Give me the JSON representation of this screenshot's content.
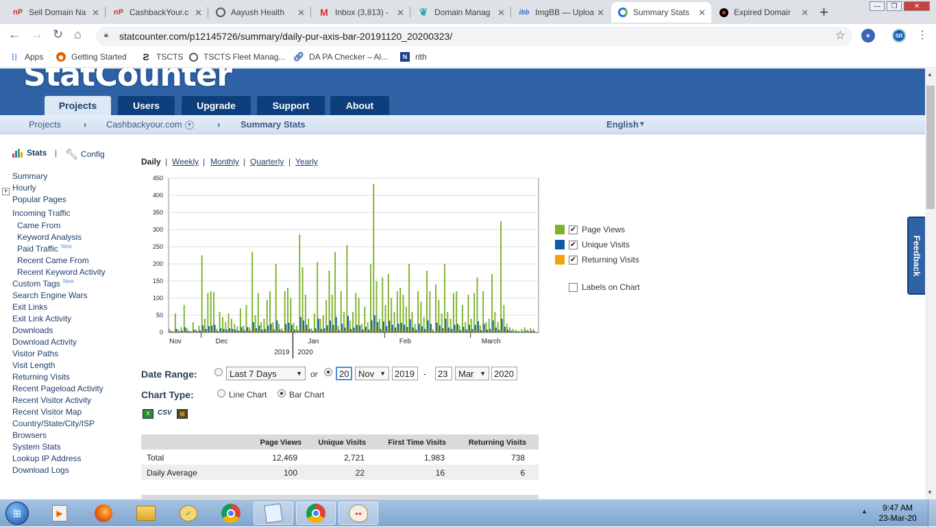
{
  "browser": {
    "tabs": [
      {
        "title": "Sell Domain Na",
        "icon": "nP"
      },
      {
        "title": "CashbackYour.c",
        "icon": "nP"
      },
      {
        "title": "Aayush Health",
        "icon": "globe"
      },
      {
        "title": "Inbox (3,813) -",
        "icon": "M"
      },
      {
        "title": "Domain Manag",
        "icon": "leaf"
      },
      {
        "title": "ImgBB — Uploa",
        "icon": "ibb"
      },
      {
        "title": "Summary Stats",
        "icon": "statcounter"
      },
      {
        "title": "Expired Domair",
        "icon": "dot"
      }
    ],
    "url": "statcounter.com/p12145726/summary/daily-pur-axis-bar-20191120_20200323/",
    "bookmarks": [
      {
        "label": "Apps"
      },
      {
        "label": "Getting Started"
      },
      {
        "label": "TSCTS"
      },
      {
        "label": "TSCTS Fleet Manag..."
      },
      {
        "label": "DA PA Checker – Al..."
      },
      {
        "label": "rith"
      }
    ],
    "extension_badge": "SR"
  },
  "site": {
    "logo_text": "StatCounter",
    "nav_tabs": [
      "Projects",
      "Users",
      "Upgrade",
      "Support",
      "About"
    ],
    "breadcrumb": [
      "Projects",
      "Cashbackyour.com",
      "Summary Stats"
    ],
    "language": "English",
    "feedback": "Feedback"
  },
  "sidebar": {
    "stats_label": "Stats",
    "config_label": "Config",
    "items": [
      "Summary",
      "Hourly",
      "Popular Pages",
      "Incoming Traffic",
      "Came From",
      "Keyword Analysis",
      "Paid Traffic",
      "Recent Came From",
      "Recent Keyword Activity",
      "Custom Tags",
      "Search Engine Wars",
      "Exit Links",
      "Exit Link Activity",
      "Downloads",
      "Download Activity",
      "Visitor Paths",
      "Visit Length",
      "Returning Visits",
      "Recent Pageload Activity",
      "Recent Visitor Activity",
      "Recent Visitor Map",
      "Country/State/City/ISP",
      "Browsers",
      "System Stats",
      "Lookup IP Address",
      "Download Logs"
    ],
    "new_tag": "New"
  },
  "periods": [
    "Daily",
    "Weekly",
    "Monthly",
    "Quarterly",
    "Yearly"
  ],
  "legend": {
    "items": [
      {
        "label": "Page Views",
        "color": "#7cb32c",
        "checked": true
      },
      {
        "label": "Unique Visits",
        "color": "#0e5aa7",
        "checked": true
      },
      {
        "label": "Returning Visits",
        "color": "#f0a30a",
        "checked": true
      }
    ],
    "labels_on_chart": "Labels on Chart"
  },
  "controls": {
    "date_range_label": "Date Range:",
    "range_preset": "Last 7 Days",
    "or": "or",
    "from_day": "20",
    "from_month": "Nov",
    "from_year": "2019",
    "dash": "-",
    "to_day": "23",
    "to_month": "Mar",
    "to_year": "2020",
    "chart_type_label": "Chart Type:",
    "line_chart": "Line Chart",
    "bar_chart": "Bar Chart",
    "export_csv": "CSV"
  },
  "table": {
    "headers": [
      "Page Views",
      "Unique Visits",
      "First Time Visits",
      "Returning Visits"
    ],
    "rows": [
      {
        "label": "Total",
        "values": [
          "12,469",
          "2,721",
          "1,983",
          "738"
        ]
      },
      {
        "label": "Daily Average",
        "values": [
          "100",
          "22",
          "16",
          "6"
        ]
      }
    ]
  },
  "taskbar": {
    "time": "9:47 AM",
    "date": "23-Mar-20"
  },
  "chart_data": {
    "type": "bar",
    "x_start": "2019-11-20",
    "x_end": "2020-03-23",
    "ylim": [
      0,
      450
    ],
    "yticks": [
      0,
      50,
      100,
      150,
      200,
      250,
      300,
      350,
      400,
      450
    ],
    "month_labels": [
      "Nov",
      "Dec",
      "Jan",
      "Feb",
      "March"
    ],
    "year_labels": [
      "2019",
      "2020"
    ],
    "series": [
      {
        "name": "Page Views",
        "color": "#7cb32c",
        "values": [
          10,
          5,
          55,
          8,
          15,
          80,
          12,
          5,
          30,
          8,
          20,
          225,
          40,
          115,
          120,
          118,
          10,
          60,
          45,
          30,
          55,
          40,
          25,
          18,
          70,
          20,
          80,
          15,
          235,
          50,
          115,
          30,
          40,
          95,
          120,
          30,
          200,
          25,
          12,
          120,
          130,
          100,
          28,
          20,
          285,
          190,
          110,
          40,
          12,
          55,
          205,
          40,
          50,
          95,
          180,
          110,
          235,
          20,
          120,
          60,
          255,
          35,
          60,
          115,
          100,
          25,
          75,
          30,
          200,
          433,
          150,
          40,
          160,
          80,
          170,
          100,
          60,
          120,
          130,
          110,
          75,
          200,
          60,
          25,
          120,
          90,
          45,
          180,
          120,
          10,
          140,
          95,
          55,
          200,
          60,
          40,
          115,
          120,
          20,
          80,
          30,
          110,
          40,
          115,
          160,
          20,
          120,
          30,
          40,
          170,
          60,
          30,
          325,
          80,
          25,
          15,
          10,
          8,
          5,
          10,
          15,
          8,
          12,
          10
        ]
      },
      {
        "name": "Unique Visits",
        "color": "#0e5aa7",
        "values": [
          3,
          2,
          10,
          3,
          5,
          15,
          4,
          2,
          8,
          3,
          6,
          20,
          10,
          18,
          20,
          22,
          4,
          12,
          10,
          8,
          12,
          10,
          8,
          5,
          15,
          6,
          15,
          5,
          30,
          12,
          20,
          8,
          10,
          20,
          25,
          8,
          35,
          8,
          4,
          25,
          28,
          22,
          8,
          6,
          45,
          35,
          22,
          10,
          4,
          12,
          40,
          10,
          12,
          20,
          35,
          22,
          45,
          6,
          25,
          14,
          48,
          10,
          14,
          22,
          20,
          8,
          16,
          8,
          35,
          50,
          30,
          10,
          32,
          18,
          34,
          22,
          14,
          25,
          28,
          22,
          16,
          38,
          14,
          8,
          25,
          18,
          10,
          35,
          25,
          3,
          28,
          20,
          12,
          40,
          14,
          10,
          22,
          25,
          6,
          16,
          8,
          22,
          10,
          22,
          32,
          6,
          25,
          8,
          10,
          35,
          14,
          8,
          40,
          16,
          8,
          5,
          3,
          3,
          2,
          3,
          5,
          3,
          4,
          3
        ]
      },
      {
        "name": "Returning Visits",
        "color": "#f0a30a",
        "values": [
          1,
          1,
          3,
          1,
          2,
          5,
          1,
          1,
          3,
          1,
          2,
          6,
          3,
          5,
          6,
          7,
          1,
          4,
          3,
          2,
          4,
          3,
          2,
          2,
          5,
          2,
          5,
          2,
          8,
          4,
          6,
          3,
          3,
          6,
          7,
          2,
          10,
          3,
          1,
          7,
          8,
          6,
          2,
          2,
          12,
          10,
          6,
          3,
          1,
          4,
          11,
          3,
          4,
          6,
          10,
          6,
          12,
          2,
          7,
          4,
          13,
          3,
          4,
          6,
          6,
          2,
          5,
          2,
          10,
          14,
          9,
          3,
          9,
          5,
          10,
          6,
          4,
          7,
          8,
          6,
          5,
          11,
          4,
          2,
          7,
          5,
          3,
          10,
          7,
          1,
          8,
          6,
          4,
          11,
          4,
          3,
          6,
          7,
          2,
          5,
          2,
          6,
          3,
          6,
          9,
          2,
          7,
          2,
          3,
          10,
          4,
          2,
          11,
          5,
          2,
          1,
          1,
          1,
          1,
          1,
          2,
          1,
          1,
          1
        ]
      }
    ]
  }
}
